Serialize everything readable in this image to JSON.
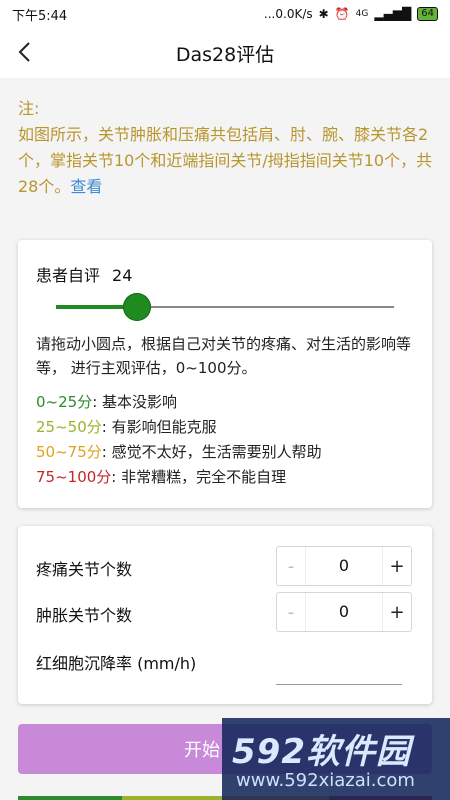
{
  "status_bar": {
    "time": "下午5:44",
    "network_speed": "...0.0K/s",
    "signal_label": "4G",
    "battery": "64"
  },
  "header": {
    "title": "Das28评估"
  },
  "note": {
    "label": "注:",
    "text": "如图所示，关节肿胀和压痛共包括肩、肘、腕、膝关节各2个，掌指关节10个和近端指间关节/拇指指间关节10个，共28个。",
    "link": "查看"
  },
  "self_assessment": {
    "label": "患者自评",
    "value": "24",
    "slider_value": 24,
    "slider_max": 100,
    "instructions": "请拖动小圆点，根据自己对关节的疼痛、对生活的影响等等， 进行主观评估，0~100分。",
    "levels": [
      {
        "range": "0~25分",
        "sep": ": ",
        "text": "基本没影响",
        "color": "#2e8b2e"
      },
      {
        "range": "25~50分",
        "sep": ": ",
        "text": "有影响但能克服",
        "color": "#9bb32a"
      },
      {
        "range": "50~75分",
        "sep": ": ",
        "text": "感觉不太好，生活需要别人帮助",
        "color": "#e0a21f"
      },
      {
        "range": "75~100分",
        "sep": ": ",
        "text": "非常糟糕，完全不能自理",
        "color": "#c0272d"
      }
    ]
  },
  "joints": {
    "pain_label": "疼痛关节个数",
    "pain_value": "0",
    "swelling_label": "肿胀关节个数",
    "swelling_value": "0",
    "minus": "-",
    "plus": "+",
    "esr_label": "红细胞沉降率 (mm/h)"
  },
  "start_button": {
    "label": "开始"
  },
  "watermark": {
    "top": "592软件园",
    "bottom": "www.592xiazai.com"
  },
  "colors": {
    "accent_green": "#1f8a1f",
    "note_gold": "#b8962e",
    "link_blue": "#3d8bd6",
    "button_purple": "#c889d8"
  }
}
